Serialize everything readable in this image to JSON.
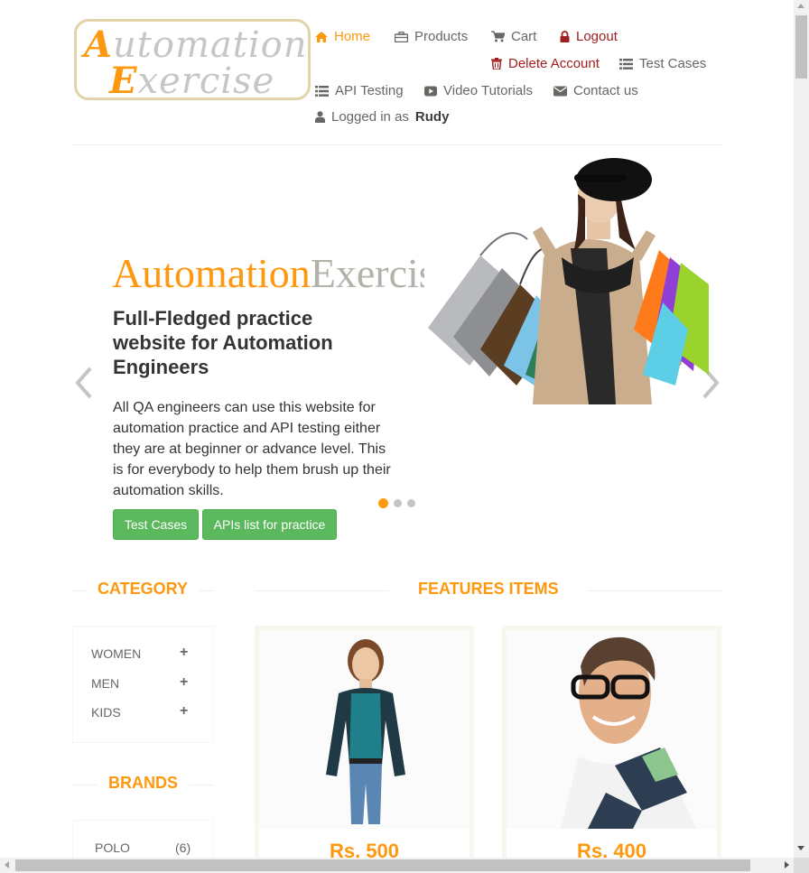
{
  "header": {
    "logo": {
      "line1": "Automation",
      "line2": "Exercise"
    },
    "nav": [
      {
        "label": "Home",
        "icon": "home-icon"
      },
      {
        "label": "Products",
        "icon": "briefcase-icon"
      },
      {
        "label": "Cart",
        "icon": "cart-icon"
      },
      {
        "label": "Logout",
        "icon": "lock-icon"
      },
      {
        "label": "Delete Account",
        "icon": "trash-icon"
      },
      {
        "label": "Test Cases",
        "icon": "list-icon"
      },
      {
        "label": "API Testing",
        "icon": "list-icon"
      },
      {
        "label": "Video Tutorials",
        "icon": "youtube-play-icon"
      },
      {
        "label": "Contact us",
        "icon": "envelope-icon"
      }
    ],
    "logged_in_prefix": "Logged in as",
    "username": "Rudy"
  },
  "slider": {
    "brand_part1": "Automation",
    "brand_part2": "Exercise",
    "heading": "Full-Fledged practice website for Automation Engineers",
    "text": "All QA engineers can use this website for automation practice and API testing either they are at beginner or advance level. This is for everybody to help them brush up their automation skills.",
    "button1": "Test Cases",
    "button2": "APIs list for practice",
    "active_slide": 1,
    "slide_count": 3
  },
  "category": {
    "title": "Category",
    "items": [
      {
        "label": "WOMEN"
      },
      {
        "label": "MEN"
      },
      {
        "label": "KIDS"
      }
    ],
    "expand_symbol": "+"
  },
  "brands": {
    "title": "Brands",
    "items": [
      {
        "label": "POLO",
        "count": "(6)"
      }
    ]
  },
  "features": {
    "title": "Features Items",
    "products": [
      {
        "price": "Rs. 500"
      },
      {
        "price": "Rs. 400"
      }
    ]
  },
  "colors": {
    "accent": "#FE980F",
    "danger_link": "#A01E1E",
    "button_green": "#5CB85C",
    "text": "#696763"
  }
}
